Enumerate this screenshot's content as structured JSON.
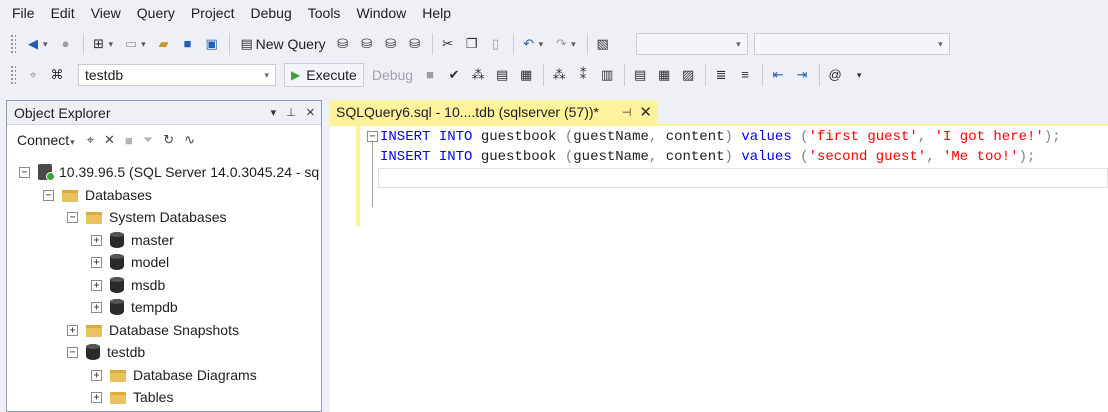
{
  "menu": [
    "File",
    "Edit",
    "View",
    "Query",
    "Project",
    "Debug",
    "Tools",
    "Window",
    "Help"
  ],
  "toolbar1": {
    "new_query_label": "New Query",
    "query_type_labels": [
      "MDX",
      "DMX",
      "XMLA",
      "DAX"
    ]
  },
  "toolbar2": {
    "database": "testdb",
    "execute_label": "Execute",
    "debug_label": "Debug"
  },
  "object_explorer": {
    "title": "Object Explorer",
    "connect_label": "Connect",
    "tree": [
      {
        "label": "10.39.96.5 (SQL Server 14.0.3045.24 - sq",
        "expander": "−",
        "icon": "server-icon",
        "level": 0
      },
      {
        "label": "Databases",
        "expander": "−",
        "icon": "folder-icon",
        "level": 1
      },
      {
        "label": "System Databases",
        "expander": "−",
        "icon": "folder-icon",
        "level": 2
      },
      {
        "label": "master",
        "expander": "+",
        "icon": "database-icon",
        "level": 3
      },
      {
        "label": "model",
        "expander": "+",
        "icon": "database-icon",
        "level": 3
      },
      {
        "label": "msdb",
        "expander": "+",
        "icon": "database-icon",
        "level": 3
      },
      {
        "label": "tempdb",
        "expander": "+",
        "icon": "database-icon",
        "level": 3
      },
      {
        "label": "Database Snapshots",
        "expander": "+",
        "icon": "folder-icon",
        "level": 2
      },
      {
        "label": "testdb",
        "expander": "−",
        "icon": "database-icon",
        "level": 2
      },
      {
        "label": "Database Diagrams",
        "expander": "+",
        "icon": "folder-icon",
        "level": 3
      },
      {
        "label": "Tables",
        "expander": "+",
        "icon": "folder-icon",
        "level": 3
      }
    ]
  },
  "document_tab": {
    "title": "SQLQuery6.sql - 10....tdb (sqlserver (57))*",
    "pin_icon": "pin-icon",
    "close_icon": "close-icon"
  },
  "editor": {
    "outline_toggle": "−",
    "lines": [
      [
        {
          "t": "kw",
          "v": "INSERT"
        },
        {
          "t": "txt",
          "v": " "
        },
        {
          "t": "kw",
          "v": "INTO"
        },
        {
          "t": "txt",
          "v": " guestbook "
        },
        {
          "t": "pun",
          "v": "("
        },
        {
          "t": "txt",
          "v": "guestName"
        },
        {
          "t": "pun",
          "v": ","
        },
        {
          "t": "txt",
          "v": " content"
        },
        {
          "t": "pun",
          "v": ")"
        },
        {
          "t": "txt",
          "v": " "
        },
        {
          "t": "kw",
          "v": "values"
        },
        {
          "t": "txt",
          "v": " "
        },
        {
          "t": "pun",
          "v": "("
        },
        {
          "t": "str",
          "v": "'first guest'"
        },
        {
          "t": "pun",
          "v": ","
        },
        {
          "t": "txt",
          "v": " "
        },
        {
          "t": "str",
          "v": "'I got here!'"
        },
        {
          "t": "pun",
          "v": ");"
        }
      ],
      [
        {
          "t": "kw",
          "v": "INSERT"
        },
        {
          "t": "txt",
          "v": " "
        },
        {
          "t": "kw",
          "v": "INTO"
        },
        {
          "t": "txt",
          "v": " guestbook "
        },
        {
          "t": "pun",
          "v": "("
        },
        {
          "t": "txt",
          "v": "guestName"
        },
        {
          "t": "pun",
          "v": ","
        },
        {
          "t": "txt",
          "v": " content"
        },
        {
          "t": "pun",
          "v": ")"
        },
        {
          "t": "txt",
          "v": " "
        },
        {
          "t": "kw",
          "v": "values"
        },
        {
          "t": "txt",
          "v": " "
        },
        {
          "t": "pun",
          "v": "("
        },
        {
          "t": "str",
          "v": "'second guest'"
        },
        {
          "t": "pun",
          "v": ","
        },
        {
          "t": "txt",
          "v": " "
        },
        {
          "t": "str",
          "v": "'Me too!'"
        },
        {
          "t": "pun",
          "v": ");"
        }
      ],
      []
    ]
  },
  "colors": {
    "keyword": "#0000ff",
    "string": "#ff0000",
    "punctuation": "#808080",
    "tab_active": "#fff29d"
  }
}
